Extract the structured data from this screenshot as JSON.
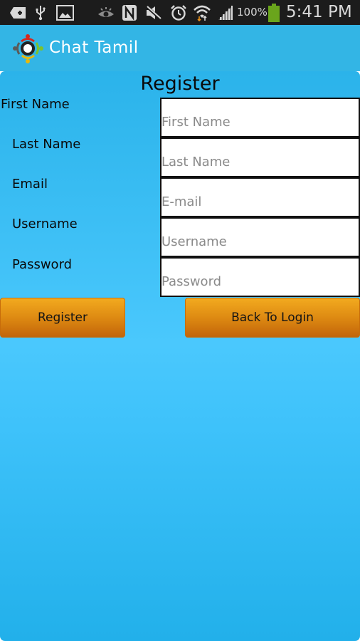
{
  "status_bar": {
    "left_icons": [
      "add-notification-icon",
      "usb-icon",
      "gallery-icon"
    ],
    "right_icons": [
      "eye-icon",
      "nfc-icon",
      "mute-icon",
      "alarm-icon",
      "wifi-icon",
      "signal-icon",
      "battery-icon"
    ],
    "battery_percent": "100%",
    "time": "5:41 PM"
  },
  "action_bar": {
    "app_title": "Chat Tamil",
    "logo_icon": "chat-tamil-logo-icon"
  },
  "form": {
    "title": "Register",
    "fields": [
      {
        "label": "First Name",
        "placeholder": "First Name",
        "value": ""
      },
      {
        "label": "Last Name",
        "placeholder": "Last Name",
        "value": ""
      },
      {
        "label": "Email",
        "placeholder": "E-mail",
        "value": ""
      },
      {
        "label": "Username",
        "placeholder": "Username",
        "value": ""
      },
      {
        "label": "Password",
        "placeholder": "Password",
        "value": ""
      }
    ],
    "register_button": "Register",
    "back_button": "Back To Login"
  },
  "colors": {
    "status_bar_bg": "#1c1c1c",
    "action_bar_bg": "#33b5e5",
    "panel_bg": "#40c3fb",
    "button_orange": "#de8a12",
    "battery_green": "#6aa51c"
  }
}
